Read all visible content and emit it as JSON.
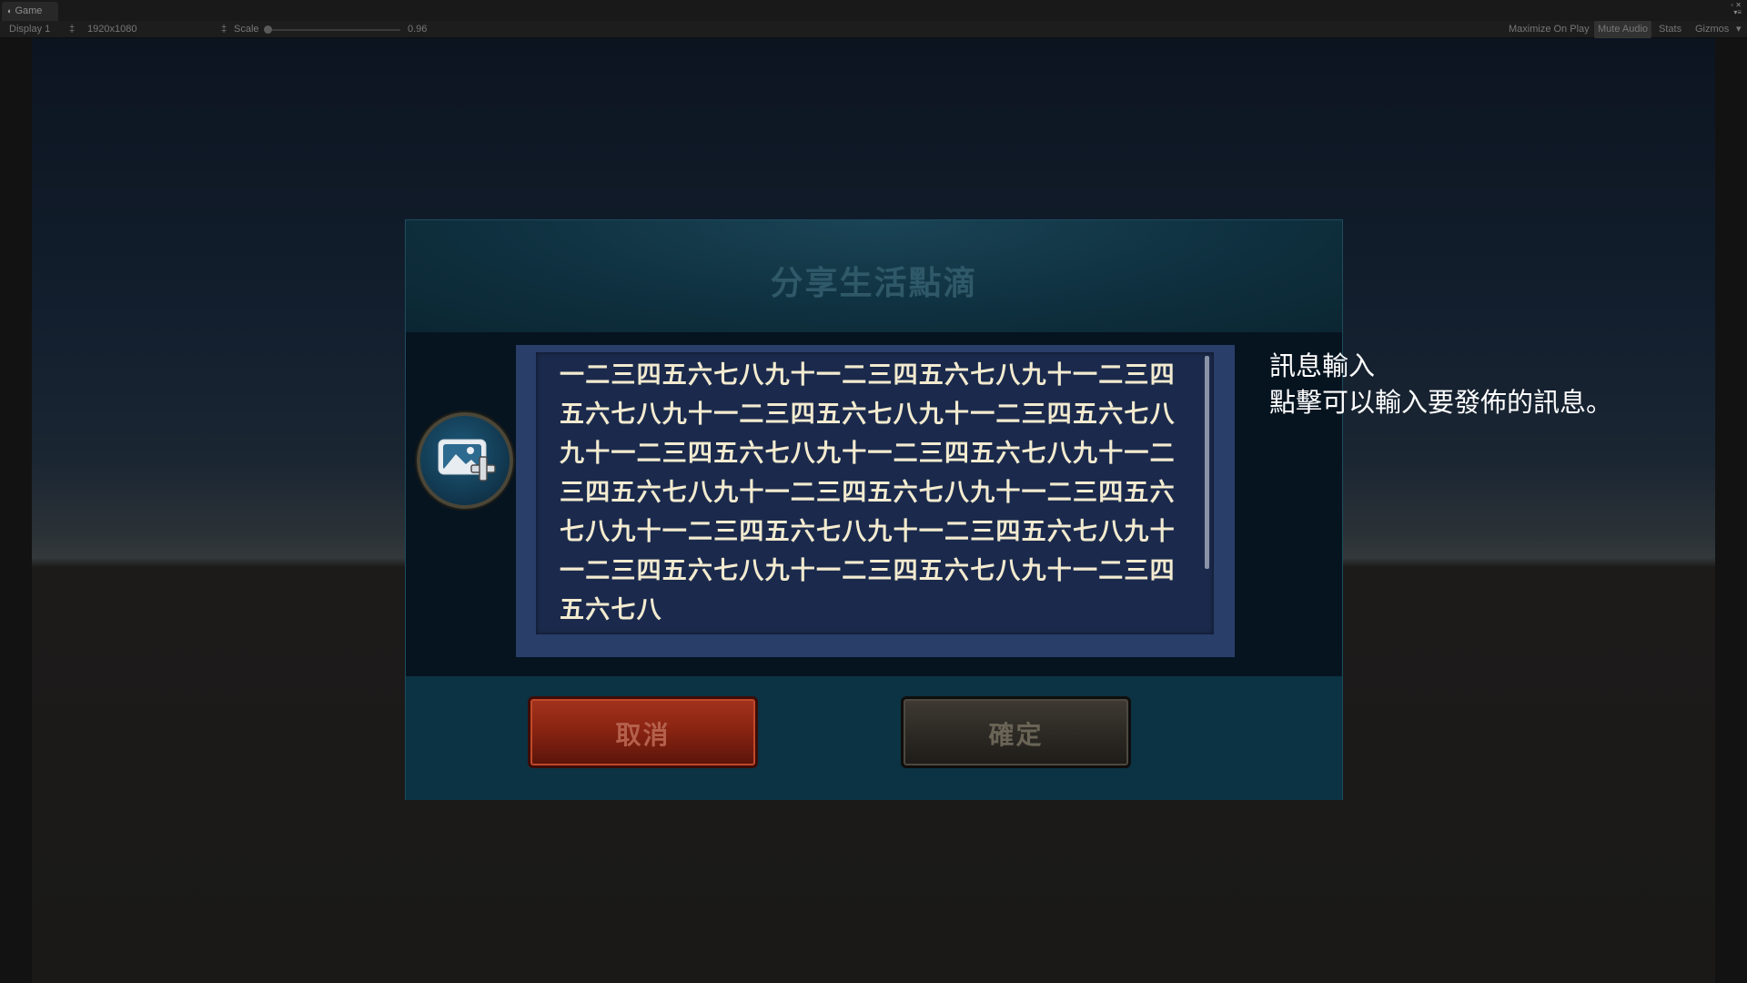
{
  "editor": {
    "tab_label": "Game",
    "display": "Display 1",
    "resolution": "1920x1080",
    "scale_label": "Scale",
    "scale_value": "0.96",
    "maximize_on_play": "Maximize On Play",
    "mute_audio": "Mute Audio",
    "stats": "Stats",
    "gizmos": "Gizmos"
  },
  "dialog": {
    "title": "分享生活點滴",
    "message": "一二三四五六七八九十一二三四五六七八九十一二三四五六七八九十一二三四五六七八九十一二三四五六七八九十一二三四五六七八九十一二三四五六七八九十一二三四五六七八九十一二三四五六七八九十一二三四五六七八九十一二三四五六七八九十一二三四五六七八九十一二三四五六七八九十一二三四五六七八九十一二三四五六七八",
    "cancel_label": "取消",
    "confirm_label": "確定",
    "scroll_fraction_visible": 0.78
  },
  "tooltip": {
    "title": "訊息輸入",
    "description": "點擊可以輸入要發佈的訊息。"
  },
  "colors": {
    "dialog_bg": "#0d2f3d",
    "text_panel": "#293e69",
    "message_text": "#f3ebd0",
    "cancel_button": "#8a2412",
    "confirm_button": "#2d2a25"
  },
  "icons": {
    "image_add": "image-add-icon"
  }
}
